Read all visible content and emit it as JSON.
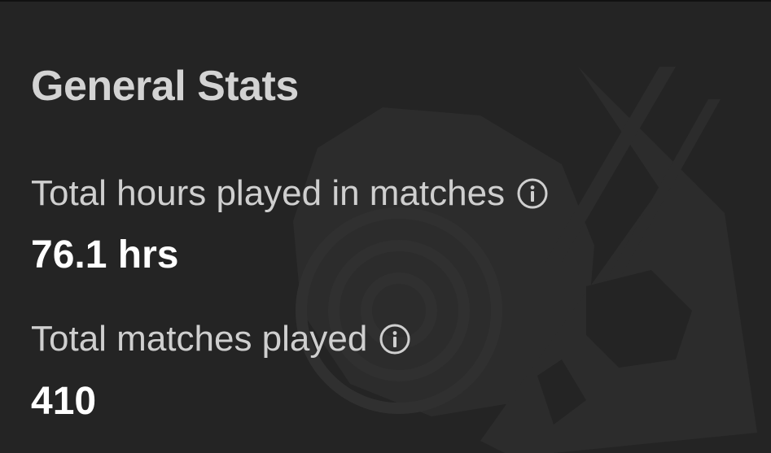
{
  "title": "General Stats",
  "stats": [
    {
      "label": "Total hours played in matches",
      "value": "76.1 hrs",
      "icon": "info-icon"
    },
    {
      "label": "Total matches played",
      "value": "410",
      "icon": "info-icon"
    }
  ],
  "watermark_icon": "skull-emblem-icon",
  "colors": {
    "background": "#242424",
    "title": "#d3d3d3",
    "label": "#cfcfcf",
    "value": "#ffffff"
  }
}
